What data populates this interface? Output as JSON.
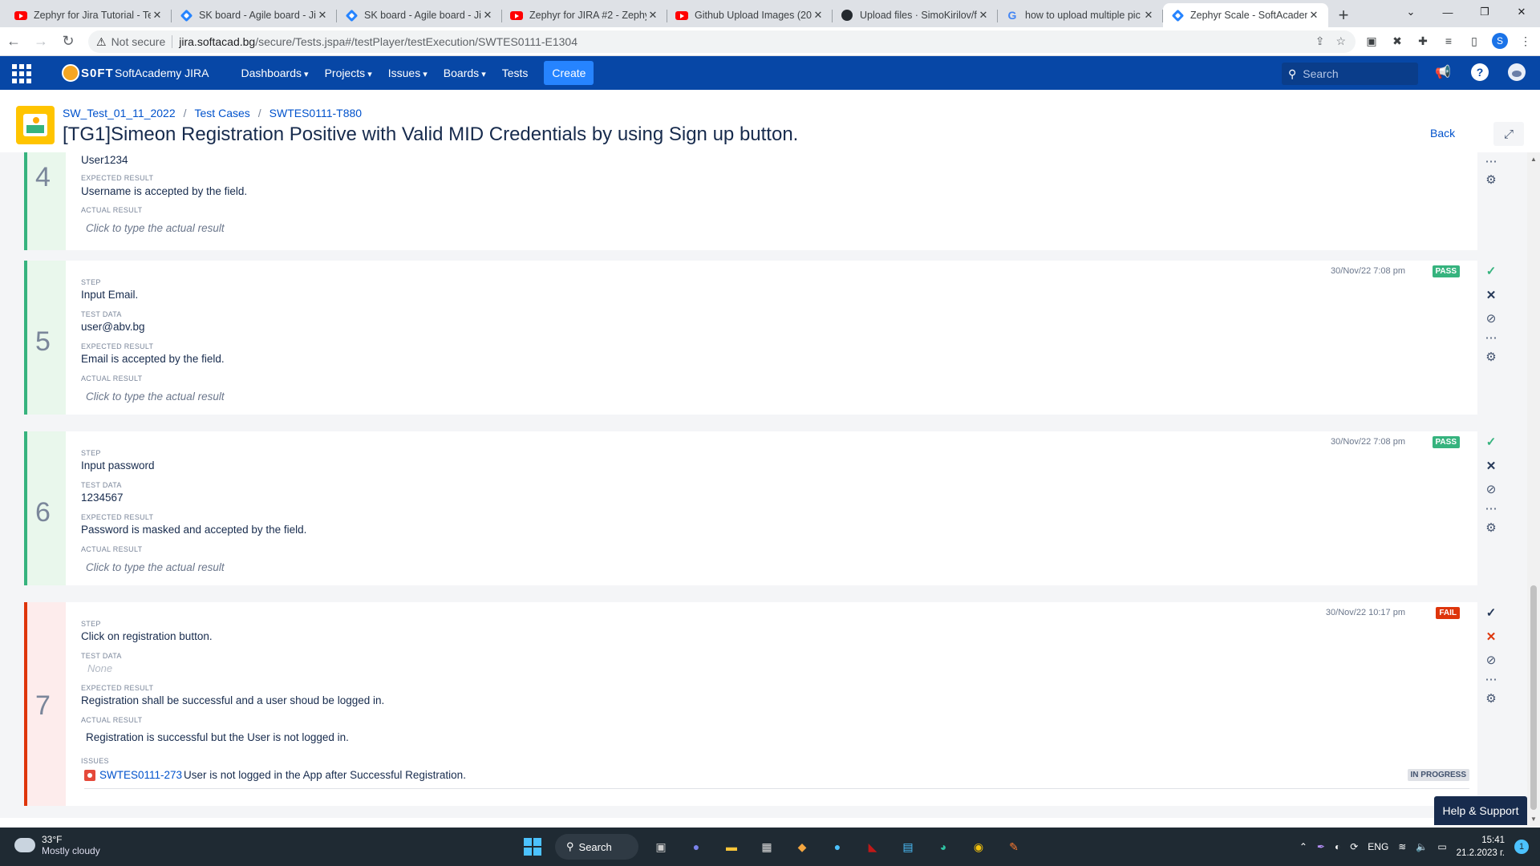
{
  "browser": {
    "tabs": [
      {
        "title": "Zephyr for Jira Tutorial - Te",
        "icon": "youtube-icon"
      },
      {
        "title": "SK board - Agile board - Jir",
        "icon": "jira-icon"
      },
      {
        "title": "SK board - Agile board - Jir",
        "icon": "jira-icon"
      },
      {
        "title": "Zephyr for JIRA #2 - Zephy",
        "icon": "youtube-icon"
      },
      {
        "title": "Github Upload Images (20",
        "icon": "youtube-icon"
      },
      {
        "title": "Upload files · SimoKirilov/f",
        "icon": "github-icon"
      },
      {
        "title": "how to upload multiple pic",
        "icon": "google-icon"
      },
      {
        "title": "Zephyr Scale - SoftAcadem",
        "icon": "jira-icon",
        "active": true
      }
    ],
    "address": {
      "security": "Not secure",
      "host": "jira.softacad.bg",
      "path": "/secure/Tests.jspa#/testPlayer/testExecution/SWTES0111-E1304"
    },
    "profile_initial": "S"
  },
  "jira": {
    "brand": "SoftAcademy JIRA",
    "logo_text": "S0FT",
    "nav": [
      "Dashboards",
      "Projects",
      "Issues",
      "Boards",
      "Tests"
    ],
    "create_label": "Create",
    "search_placeholder": "Search"
  },
  "issue": {
    "breadcrumbs": [
      "SW_Test_01_11_2022",
      "Test Cases",
      "SWTES0111-T880"
    ],
    "title": "[TG1]Simeon Registration Positive with Valid MID Credentials by using Sign up button.",
    "back_label": "Back"
  },
  "labels": {
    "step": "Step",
    "test_data": "Test data",
    "expected": "Expected result",
    "actual": "Actual result",
    "issues": "Issues",
    "actual_placeholder": "Click to type the actual result",
    "none": "None"
  },
  "steps": [
    {
      "num": "4",
      "status": "pass",
      "test_data": "User1234",
      "expected": "Username is accepted by the field."
    },
    {
      "num": "5",
      "status": "pass",
      "timestamp": "30/Nov/22 7:08 pm",
      "badge": "PASS",
      "step": "Input Email.",
      "test_data": "user@abv.bg",
      "expected": "Email is accepted by the field."
    },
    {
      "num": "6",
      "status": "pass",
      "timestamp": "30/Nov/22 7:08 pm",
      "badge": "PASS",
      "step": "Input password",
      "test_data": "1234567",
      "expected": "Password is masked and accepted by the field."
    },
    {
      "num": "7",
      "status": "fail",
      "timestamp": "30/Nov/22 10:17 pm",
      "badge": "FAIL",
      "step": "Click on registration button.",
      "expected": "Registration shall be successful and a user shoud be logged in.",
      "actual": "Registration is successful but the User is not logged in.",
      "issue_key": "SWTES0111-273",
      "issue_summary": "User is not logged in the App after Successful Registration.",
      "issue_status": "IN PROGRESS"
    }
  ],
  "help_label": "Help & Support",
  "taskbar": {
    "temp": "33°F",
    "weather": "Mostly cloudy",
    "search": "Search",
    "lang": "ENG",
    "time": "15:41",
    "date": "21.2.2023 г.",
    "notifications": "1"
  }
}
